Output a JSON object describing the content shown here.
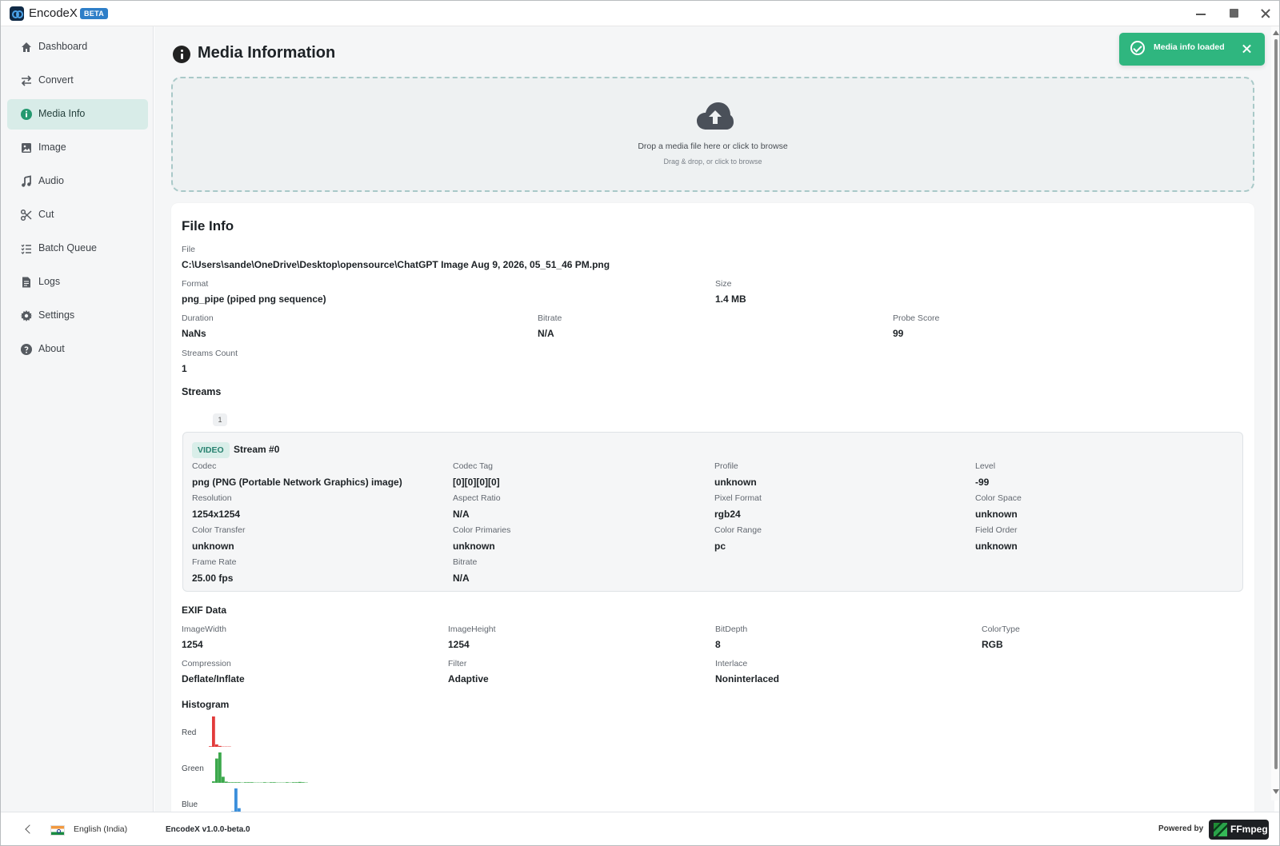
{
  "app": {
    "title": "EncodeX",
    "badge": "BETA",
    "version": "EncodeX v1.0.0-beta.0",
    "language": "English (India)",
    "powered_by": "Powered by",
    "ffmpeg": "FFmpeg"
  },
  "window_controls": [
    "minimize",
    "maximize",
    "close"
  ],
  "sidebar": {
    "items": [
      {
        "label": "Dashboard",
        "icon": "house-icon"
      },
      {
        "label": "Convert",
        "icon": "swap-icon"
      },
      {
        "label": "Media Info",
        "icon": "info-icon",
        "active": true
      },
      {
        "label": "Image",
        "icon": "image-icon"
      },
      {
        "label": "Audio",
        "icon": "music-icon"
      },
      {
        "label": "Cut",
        "icon": "scissors-icon"
      },
      {
        "label": "Batch Queue",
        "icon": "list-icon"
      },
      {
        "label": "Logs",
        "icon": "document-icon"
      },
      {
        "label": "Settings",
        "icon": "gear-icon"
      },
      {
        "label": "About",
        "icon": "help-icon"
      }
    ]
  },
  "page": {
    "title": "Media Information"
  },
  "toast": {
    "message": "Media info loaded",
    "color": "#2fb67f"
  },
  "dropzone": {
    "title": "Drop a media file here or click to browse",
    "subtitle": "Drag & drop, or click to browse"
  },
  "file_info": {
    "title": "File Info",
    "file_label": "File",
    "file_path": "C:\\Users\\sande\\OneDrive\\Desktop\\opensource\\ChatGPT Image Aug 9, 2026, 05_51_46 PM.png",
    "format_label": "Format",
    "format": "png_pipe (piped png sequence)",
    "size_label": "Size",
    "size": "1.4 MB",
    "duration_label": "Duration",
    "duration": "NaNs",
    "bitrate_label": "Bitrate",
    "bitrate": "N/A",
    "probe_score_label": "Probe Score",
    "probe_score": "99",
    "streams_count_label": "Streams Count",
    "streams_count": "1"
  },
  "streams": {
    "title": "Streams",
    "count": "1",
    "items": [
      {
        "type": "VIDEO",
        "name": "Stream #0",
        "fields": [
          [
            "Codec",
            "png (PNG (Portable Network Graphics) image)"
          ],
          [
            "Codec Tag",
            "[0][0][0][0]"
          ],
          [
            "Profile",
            "unknown"
          ],
          [
            "Level",
            "-99"
          ],
          [
            "Resolution",
            "1254x1254"
          ],
          [
            "Aspect Ratio",
            "N/A"
          ],
          [
            "Pixel Format",
            "rgb24"
          ],
          [
            "Color Space",
            "unknown"
          ],
          [
            "Color Transfer",
            "unknown"
          ],
          [
            "Color Primaries",
            "unknown"
          ],
          [
            "Color Range",
            "pc"
          ],
          [
            "Field Order",
            "unknown"
          ],
          [
            "Frame Rate",
            "25.00 fps"
          ],
          [
            "Bitrate",
            "N/A"
          ]
        ]
      }
    ]
  },
  "exif": {
    "title": "EXIF Data",
    "fields": [
      [
        "ImageWidth",
        "1254"
      ],
      [
        "ImageHeight",
        "1254"
      ],
      [
        "BitDepth",
        "8"
      ],
      [
        "ColorType",
        "RGB"
      ],
      [
        "Compression",
        "Deflate/Inflate"
      ],
      [
        "Filter",
        "Adaptive"
      ],
      [
        "Interlace",
        "Noninterlaced"
      ]
    ]
  },
  "histogram": {
    "title": "Histogram",
    "channels": [
      {
        "name": "Red",
        "color": "#e23b3b",
        "levels": [
          0.02,
          1.0,
          0.08,
          0.03,
          0.01,
          0.01,
          0.01,
          0,
          0,
          0,
          0,
          0,
          0,
          0,
          0,
          0,
          0,
          0,
          0,
          0,
          0,
          0,
          0,
          0,
          0,
          0,
          0,
          0,
          0,
          0
        ]
      },
      {
        "name": "Green",
        "color": "#3ca84c",
        "levels": [
          0.05,
          0.8,
          1.0,
          0.2,
          0.04,
          0.02,
          0.02,
          0.02,
          0.02,
          0.01,
          0.02,
          0.02,
          0.02,
          0.01,
          0.01,
          0.01,
          0.02,
          0.01,
          0.02,
          0.02,
          0.01,
          0.01,
          0.01,
          0.02,
          0.01,
          0.02,
          0.02,
          0.03,
          0.02,
          0.01
        ]
      },
      {
        "name": "Blue",
        "color": "#3b8fdb",
        "levels": [
          0.01,
          0.02,
          0.03,
          0.12,
          0.25,
          1.0,
          0.35,
          0.12,
          0.04,
          0.02,
          0.01,
          0.01,
          0.01,
          0.01,
          0.01,
          0.01,
          0.01,
          0.01,
          0.01,
          0.02,
          0.02,
          0.03,
          0.04,
          0.03,
          0.05,
          0.04,
          0.03,
          0.04,
          0.02,
          0.01
        ]
      }
    ]
  }
}
